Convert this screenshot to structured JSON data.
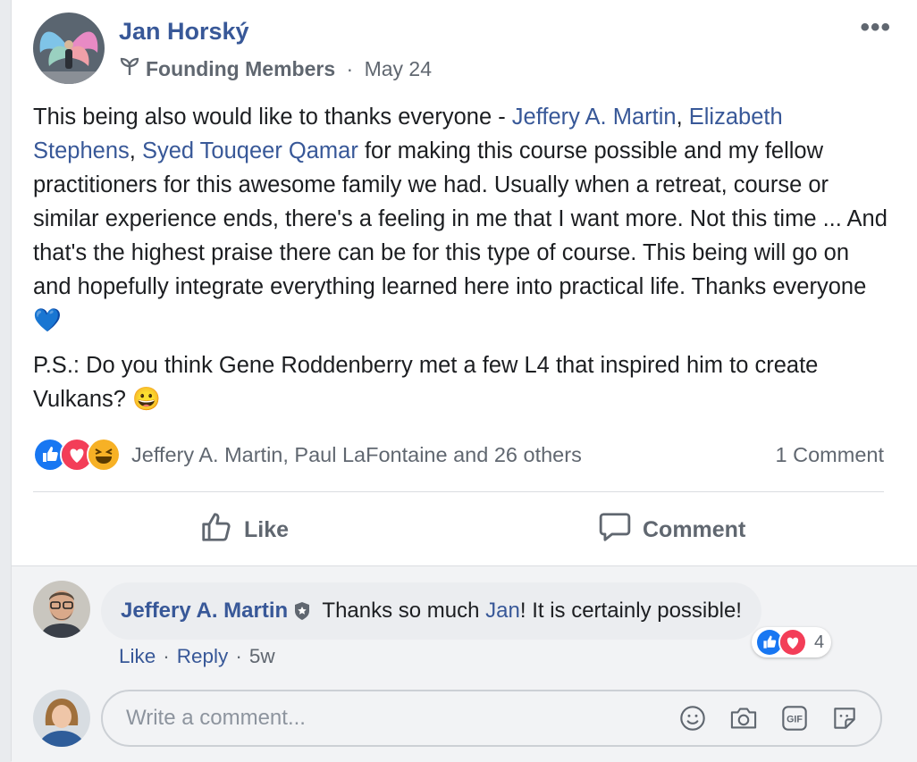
{
  "post": {
    "author": "Jan Horský",
    "group": "Founding Members",
    "separator": " · ",
    "date": "May 24",
    "more": "•••",
    "p1": {
      "t1": "This being also would like to thanks everyone - ",
      "m1": "Jeffery A. Martin",
      "t2": ", ",
      "m2": "Elizabeth Stephens",
      "t3": ", ",
      "m3": "Syed Touqeer Qamar",
      "t4": " for making this course possible and my fellow practitioners for this awesome family we had. Usually when a retreat, course or similar experience ends, there's a feeling in me that I want more. Not this time ... And that's the highest praise there can be for this type of course. This being will go on and hopefully integrate everything learned here into practical life. Thanks everyone ",
      "emoji": "💙"
    },
    "p2": {
      "text": "P.S.: Do you think Gene Roddenberry met a few L4 that inspired him to create Vulkans? ",
      "emoji": "😀"
    },
    "reactions_text": "Jeffery A. Martin, Paul LaFontaine and 26 others",
    "comment_count": "1 Comment",
    "like_label": "Like",
    "comment_label": "Comment"
  },
  "comment": {
    "author": "Jeffery A. Martin",
    "text_before": " Thanks so much ",
    "mention": "Jan",
    "text_after": "! It is certainly possible!",
    "like": "Like",
    "reply": "Reply",
    "dot": "·",
    "time": "5w",
    "reaction_count": "4"
  },
  "composer": {
    "placeholder": "Write a comment..."
  },
  "colors": {
    "link": "#385898",
    "like_blue": "#1877f2",
    "love_red": "#f33e58",
    "haha_yellow": "#f7b125"
  },
  "icons": [
    "sprout-icon",
    "thumbs-up-icon",
    "comment-bubble-icon",
    "shield-badge-icon",
    "emoji-icon",
    "camera-icon",
    "gif-icon",
    "sticker-icon"
  ]
}
